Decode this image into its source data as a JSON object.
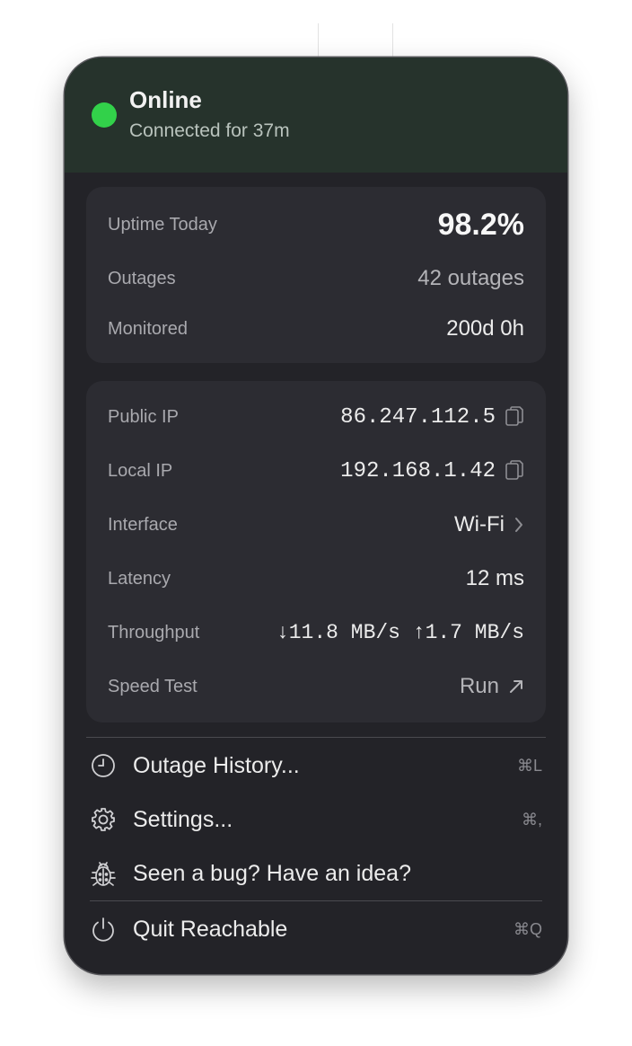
{
  "status": {
    "title": "Online",
    "subtitle": "Connected for 37m",
    "indicator_color": "#32d14a"
  },
  "stats": {
    "uptime_label": "Uptime Today",
    "uptime_value": "98.2%",
    "outages_label": "Outages",
    "outages_value": "42 outages",
    "monitored_label": "Monitored",
    "monitored_value": "200d 0h"
  },
  "network": {
    "public_ip_label": "Public IP",
    "public_ip_value": "86.247.112.5",
    "local_ip_label": "Local IP",
    "local_ip_value": "192.168.1.42",
    "interface_label": "Interface",
    "interface_value": "Wi-Fi",
    "latency_label": "Latency",
    "latency_value": "12 ms",
    "throughput_label": "Throughput",
    "throughput_value": "↓11.8 MB/s ↑1.7 MB/s",
    "speedtest_label": "Speed Test",
    "speedtest_value": "Run"
  },
  "menu": {
    "items": [
      {
        "label": "Outage History...",
        "shortcut": "⌘L",
        "icon": "clock-icon"
      },
      {
        "label": "Settings...",
        "shortcut": "⌘,",
        "icon": "gear-icon"
      },
      {
        "label": "Seen a bug? Have an idea?",
        "shortcut": "",
        "icon": "bug-icon"
      },
      {
        "label": "Quit Reachable",
        "shortcut": "⌘Q",
        "icon": "power-icon"
      }
    ]
  }
}
